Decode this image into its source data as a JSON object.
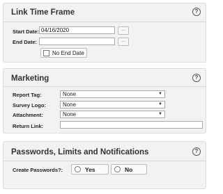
{
  "link_time_frame": {
    "title": "Link Time Frame",
    "help": "?",
    "start_date_label": "Start Date:",
    "start_date_value": "04/16/2020",
    "end_date_label": "End Date:",
    "end_date_value": "",
    "calendar_button": "...",
    "no_end_date_label": "No End Date"
  },
  "marketing": {
    "title": "Marketing",
    "help": "?",
    "report_tag_label": "Report Tag:",
    "report_tag_value": "None",
    "survey_logo_label": "Survey Logo:",
    "survey_logo_value": "None",
    "attachment_label": "Attachment:",
    "attachment_value": "None",
    "return_link_label": "Return Link:",
    "return_link_value": "",
    "caret": "▼"
  },
  "passwords": {
    "title": "Passwords, Limits and Notifications",
    "help": "?",
    "create_passwords_label": "Create Passwords?:",
    "yes_label": "Yes",
    "no_label": "No"
  }
}
